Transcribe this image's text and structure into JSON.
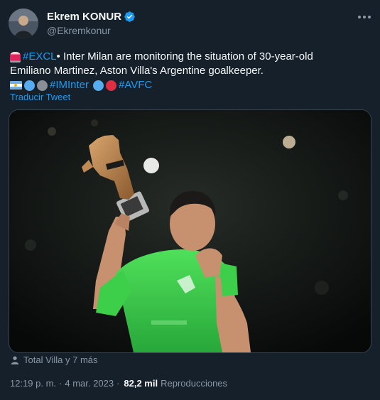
{
  "author": {
    "name": "Ekrem KONUR",
    "handle": "@Ekremkonur"
  },
  "tweet": {
    "line1_hashtag": "#EXCL",
    "line1_text": "• Inter Milan are monitoring the situation of 30-year-old",
    "line2_text": "Emiliano Martinez, Aston Villa's Argentine goalkeeper.",
    "hashtag_inter": "#IMInter",
    "hashtag_avfc": "#AVFC",
    "translate_label": "Traducir Tweet"
  },
  "tagged": {
    "text": "Total Villa y 7 más"
  },
  "meta": {
    "time": "12:19 p. m.",
    "separator": "·",
    "date": "4 mar. 2023",
    "views_count": "82,2 mil",
    "views_label": "Reproducciones"
  },
  "colors": {
    "background": "#15202b",
    "link": "#1d9bf0",
    "secondary_text": "#8b98a5",
    "jersey": "#3ecf4a"
  },
  "icons": {
    "verified": "verified-badge-icon",
    "more": "more-options-icon",
    "tagged": "person-icon"
  }
}
